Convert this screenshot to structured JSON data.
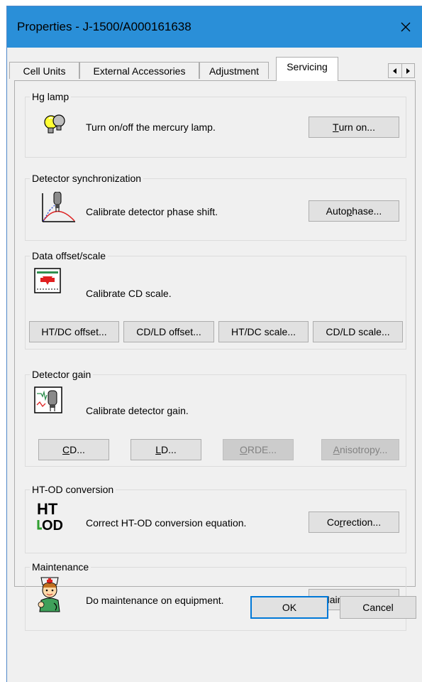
{
  "window": {
    "title": "Properties - J-1500/A000161638"
  },
  "tabs": [
    {
      "label": "Cell Units",
      "active": false
    },
    {
      "label": "External Accessories",
      "active": false
    },
    {
      "label": "Adjustment",
      "active": false
    },
    {
      "label": "Servicing",
      "active": true
    }
  ],
  "groups": {
    "hg_lamp": {
      "title": "Hg lamp",
      "icon": "lightbulbs-icon",
      "description": "Turn on/off the mercury lamp.",
      "button": {
        "mnemonic": "T",
        "rest": "urn on..."
      }
    },
    "detector_sync": {
      "title": "Detector synchronization",
      "icon": "phase-curve-icon",
      "description": "Calibrate detector phase shift.",
      "button": {
        "before": "Auto ",
        "mnemonic": "p",
        "after": "hase..."
      }
    },
    "data_offset": {
      "title": "Data offset/scale",
      "icon": "cd-scale-icon",
      "description": "Calibrate CD scale.",
      "buttons": [
        "HT/DC offset...",
        "CD/LD offset...",
        "HT/DC scale...",
        "CD/LD scale..."
      ]
    },
    "detector_gain": {
      "title": "Detector gain",
      "icon": "detector-gain-icon",
      "description": "Calibrate detector gain.",
      "buttons": [
        {
          "mnemonic": "C",
          "rest": "D...",
          "enabled": true
        },
        {
          "mnemonic": "L",
          "rest": "D...",
          "enabled": true
        },
        {
          "mnemonic": "O",
          "rest": "RDE...",
          "enabled": false
        },
        {
          "mnemonic": "A",
          "rest": "nisotropy...",
          "enabled": false
        }
      ]
    },
    "ht_od": {
      "title": "HT-OD conversion",
      "icon": "ht-od-icon",
      "icon_text_top": "HT",
      "icon_text_bottom": "OD",
      "description": "Correct HT-OD conversion equation.",
      "button": {
        "before": "Co",
        "mnemonic": "r",
        "after": "rection..."
      }
    },
    "maintenance": {
      "title": "Maintenance",
      "icon": "nurse-icon",
      "description": "Do maintenance on equipment.",
      "button": {
        "before": "Maintenanc",
        "mnemonic": "e",
        "after": "..."
      }
    }
  },
  "footer": {
    "ok": "OK",
    "cancel": "Cancel"
  },
  "colors": {
    "titlebar": "#2a8fd8",
    "accent": "#0078d7"
  }
}
